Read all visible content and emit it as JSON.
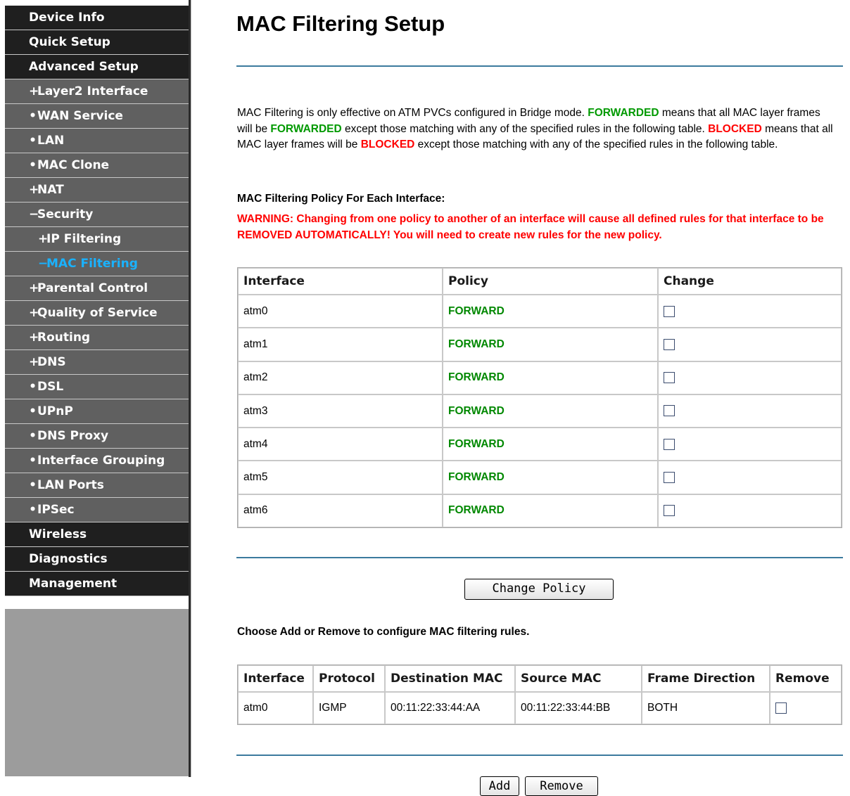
{
  "sidebar": {
    "items": [
      {
        "label": "Device Info",
        "symbol": "",
        "level": "top",
        "active": false
      },
      {
        "label": "Quick Setup",
        "symbol": "",
        "level": "top",
        "active": false
      },
      {
        "label": "Advanced Setup",
        "symbol": "",
        "level": "top",
        "active": false
      },
      {
        "label": "Layer2 Interface",
        "symbol": "+",
        "level": "sub",
        "active": false
      },
      {
        "label": "WAN Service",
        "symbol": "•",
        "level": "sub",
        "active": false
      },
      {
        "label": "LAN",
        "symbol": "•",
        "level": "sub",
        "active": false
      },
      {
        "label": "MAC Clone",
        "symbol": "•",
        "level": "sub",
        "active": false
      },
      {
        "label": "NAT",
        "symbol": "+",
        "level": "sub",
        "active": false
      },
      {
        "label": "Security",
        "symbol": "−",
        "level": "sub",
        "active": false
      },
      {
        "label": "IP Filtering",
        "symbol": "+",
        "level": "sub2",
        "active": false
      },
      {
        "label": "MAC Filtering",
        "symbol": "−",
        "level": "sub2",
        "active": true
      },
      {
        "label": "Parental Control",
        "symbol": "+",
        "level": "sub",
        "active": false
      },
      {
        "label": "Quality of Service",
        "symbol": "+",
        "level": "sub",
        "active": false
      },
      {
        "label": "Routing",
        "symbol": "+",
        "level": "sub",
        "active": false
      },
      {
        "label": "DNS",
        "symbol": "+",
        "level": "sub",
        "active": false
      },
      {
        "label": "DSL",
        "symbol": "•",
        "level": "sub",
        "active": false
      },
      {
        "label": "UPnP",
        "symbol": "•",
        "level": "sub",
        "active": false
      },
      {
        "label": "DNS Proxy",
        "symbol": "•",
        "level": "sub",
        "active": false
      },
      {
        "label": "Interface Grouping",
        "symbol": "•",
        "level": "sub",
        "active": false
      },
      {
        "label": "LAN Ports",
        "symbol": "•",
        "level": "sub",
        "active": false
      },
      {
        "label": "IPSec",
        "symbol": "•",
        "level": "sub",
        "active": false
      },
      {
        "label": "Wireless",
        "symbol": "",
        "level": "top",
        "active": false
      },
      {
        "label": "Diagnostics",
        "symbol": "",
        "level": "top",
        "active": false
      },
      {
        "label": "Management",
        "symbol": "",
        "level": "top",
        "active": false
      }
    ]
  },
  "page": {
    "title": "MAC Filtering Setup",
    "intro": {
      "t1": "MAC Filtering is only effective on ATM PVCs configured in Bridge mode.",
      "forwarded": "FORWARDED",
      "t2": "means that all MAC layer frames will be",
      "t3": "except those matching with any of the specified rules in the following table.",
      "blocked": "BLOCKED",
      "t4": "means that all MAC layer frames will be",
      "t5": "except those matching with any of the specified rules in the following table."
    },
    "policy_heading": "MAC Filtering Policy For Each Interface:",
    "warning": "WARNING: Changing from one policy to another of an interface will cause all defined rules for that interface to be REMOVED AUTOMATICALLY! You will need to create new rules for the new policy.",
    "policy_table": {
      "headers": [
        "Interface",
        "Policy",
        "Change"
      ],
      "rows": [
        {
          "interface": "atm0",
          "policy": "FORWARD",
          "checked": false
        },
        {
          "interface": "atm1",
          "policy": "FORWARD",
          "checked": false
        },
        {
          "interface": "atm2",
          "policy": "FORWARD",
          "checked": false
        },
        {
          "interface": "atm3",
          "policy": "FORWARD",
          "checked": false
        },
        {
          "interface": "atm4",
          "policy": "FORWARD",
          "checked": false
        },
        {
          "interface": "atm5",
          "policy": "FORWARD",
          "checked": false
        },
        {
          "interface": "atm6",
          "policy": "FORWARD",
          "checked": false
        }
      ]
    },
    "change_policy_button": "Change Policy",
    "rules_heading": "Choose Add or Remove to configure MAC filtering rules.",
    "rules_table": {
      "headers": [
        "Interface",
        "Protocol",
        "Destination MAC",
        "Source MAC",
        "Frame Direction",
        "Remove"
      ],
      "rows": [
        {
          "interface": "atm0",
          "protocol": "IGMP",
          "dest_mac": "00:11:22:33:44:AA",
          "src_mac": "00:11:22:33:44:BB",
          "direction": "BOTH",
          "checked": false
        }
      ]
    },
    "add_button": "Add",
    "remove_button": "Remove"
  },
  "colors": {
    "sidebar_top": "#1f1f1f",
    "sidebar_sub": "#606060",
    "sidebar_active": "#1ab2ff",
    "rule_line": "#3b7a9e",
    "forward_green": "#009900",
    "warning_red": "#ff0000"
  }
}
